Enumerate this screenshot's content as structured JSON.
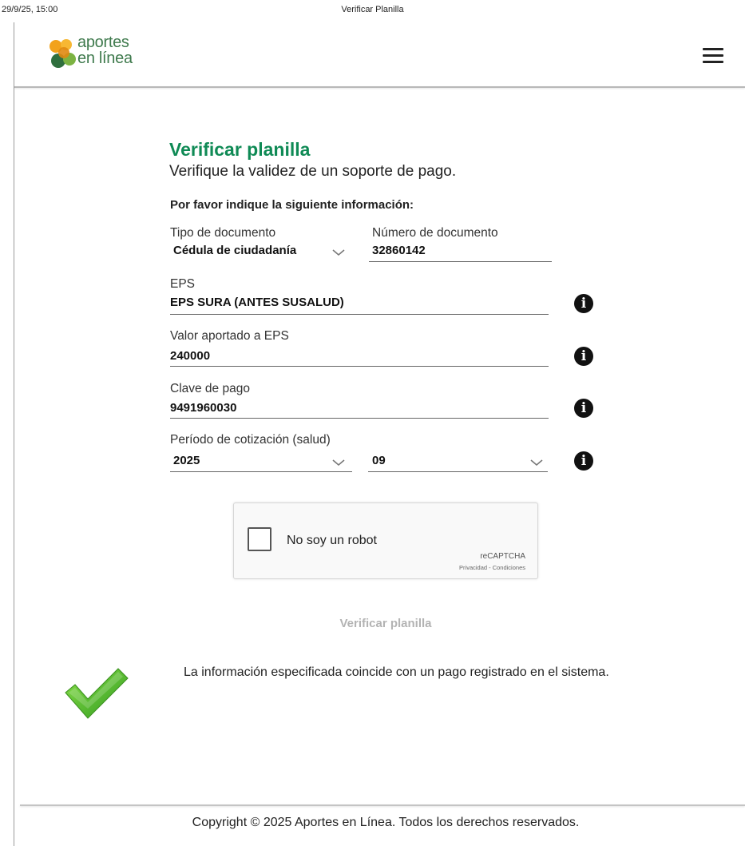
{
  "print": {
    "date": "29/9/25, 15:00",
    "title": "Verificar Planilla"
  },
  "header": {
    "logo_line1": "aportes",
    "logo_line2": "en línea",
    "menu_icon": "hamburger-menu-icon"
  },
  "form": {
    "title": "Verificar planilla",
    "subtitle": "Verifique la validez de un soporte de pago.",
    "instructions": "Por favor indique la siguiente información:",
    "tipo_documento": {
      "label": "Tipo de documento",
      "value": "Cédula de ciudadanía"
    },
    "numero_documento": {
      "label": "Número de documento",
      "value": "32860142"
    },
    "eps": {
      "label": "EPS",
      "value": "EPS SURA (ANTES SUSALUD)"
    },
    "valor_eps": {
      "label": "Valor aportado a EPS",
      "value": "240000"
    },
    "clave_pago": {
      "label": "Clave de pago",
      "value": "9491960030"
    },
    "periodo": {
      "label": "Período de cotización (salud)",
      "year": "2025",
      "month": "09"
    },
    "submit_label": "Verificar planilla"
  },
  "captcha": {
    "label": "No soy un robot",
    "brand": "reCAPTCHA",
    "links": "Privacidad - Condiciones"
  },
  "result": {
    "message": "La información especificada coincide con un pago registrado en el sistema.",
    "icon": "green-check-icon"
  },
  "footer": {
    "copyright": "Copyright © 2025 Aportes en Línea. Todos los derechos reservados."
  },
  "colors": {
    "brand_green": "#0f8a55",
    "logo_orange": "#f2a21b",
    "logo_dark_green": "#2f6f3e",
    "logo_light_green": "#7cb342",
    "check_green": "#5bbf2a"
  }
}
